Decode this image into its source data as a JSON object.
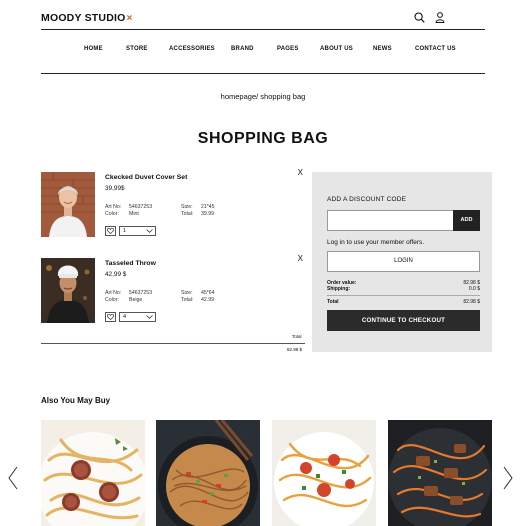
{
  "brand": {
    "name": "MOODY STUDIO",
    "mark": "×",
    "mark_color": "#e8591a"
  },
  "header": {
    "icons": [
      "search-icon",
      "user-icon"
    ]
  },
  "nav": [
    "HOME",
    "STORE",
    "ACCESSORIES",
    "BRAND",
    "PAGES",
    "ABOUT US",
    "NEWS",
    "CONTACT US"
  ],
  "breadcrumb": "homepage/ shopping bag",
  "page_title": "SHOPPING BAG",
  "cart": {
    "items": [
      {
        "name": "Ckecked Duvet Cover Set",
        "price": "39,99$",
        "art_no_label": "Art No:",
        "art_no": "54637253",
        "color_label": "Color:",
        "color": "Mint",
        "size_label": "Size:",
        "size": "21*45",
        "total_label": "Total:",
        "total": "39.99",
        "qty": "1",
        "remove": "X",
        "image": "woman-portrait"
      },
      {
        "name": "Tasseled Throw",
        "price": "42,99 $",
        "art_no_label": "Art No:",
        "art_no": "54637253",
        "color_label": "Color:",
        "color": "Beige",
        "size_label": "Size:",
        "size": "45*64",
        "total_label": "Total:",
        "total": "42.99",
        "qty": "4",
        "remove": "X",
        "image": "chef-portrait"
      }
    ],
    "total_label": "Total",
    "total_value": "82.98 $"
  },
  "summary": {
    "discount_label": "ADD A DISCOUNT CODE",
    "discount_placeholder": "",
    "add_label": "ADD",
    "login_hint": "Log in to use your member offers.",
    "login_label": "LOGIN",
    "order_value_label": "Order value:",
    "order_value": "82.98 $",
    "shipping_label": "Shipping:",
    "shipping": "0.0 $",
    "total_label": "Total",
    "total": "82.98 $",
    "checkout_label": "CONTINUE TO CHECKOUT"
  },
  "also": {
    "title": "Also You May Buy",
    "products": [
      "pasta-with-sausage",
      "noodles-stir-fry",
      "spicy-noodles",
      "pasta-with-chicken"
    ]
  }
}
